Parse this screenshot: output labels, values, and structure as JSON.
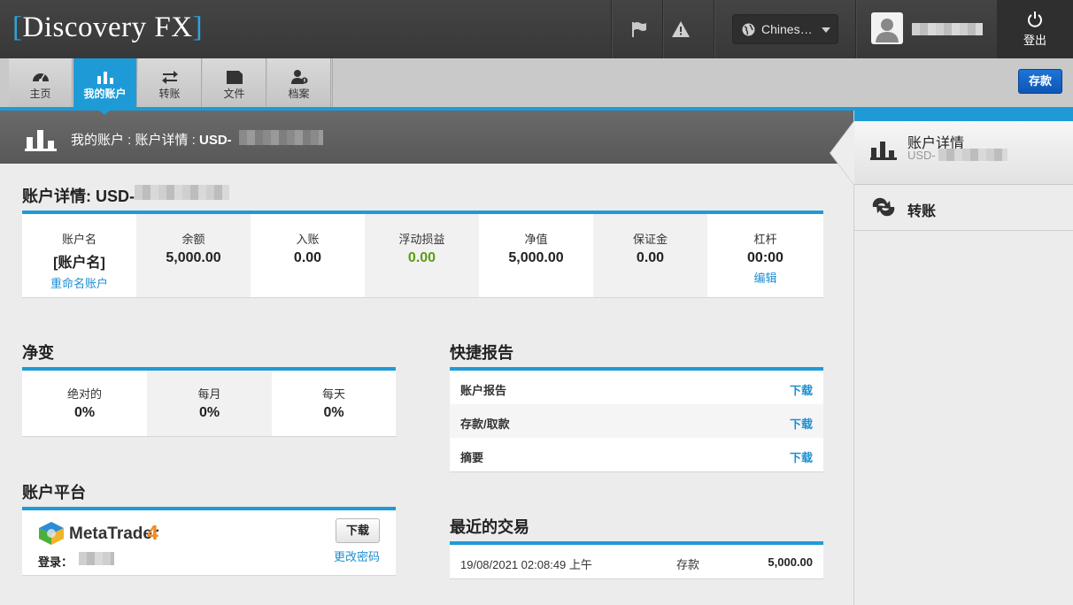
{
  "header": {
    "logo_bracket_open": "[",
    "logo_text": "Discovery FX",
    "logo_bracket_close": "]",
    "language": "Chines…",
    "logout_label": "登出"
  },
  "nav": {
    "items": [
      {
        "label": "主页",
        "icon": "dashboard-icon"
      },
      {
        "label": "我的账户",
        "icon": "bar-chart-icon",
        "active": true
      },
      {
        "label": "转账",
        "icon": "transfer-arrows-icon"
      },
      {
        "label": "文件",
        "icon": "folder-icon"
      },
      {
        "label": "档案",
        "icon": "profile-icon"
      }
    ],
    "deposit_label": "存款"
  },
  "breadcrumb": {
    "part1": "我的账户 : 账户详情 : ",
    "account": "USD-"
  },
  "sidebar": {
    "active_title": "账户详情",
    "active_sub": "USD-",
    "item2": "转账"
  },
  "account_details": {
    "title": "账户详情: USD-",
    "columns": [
      {
        "title": "账户名",
        "value": "[账户名]",
        "link": "重命名账户"
      },
      {
        "title": "余额",
        "value": "5,000.00"
      },
      {
        "title": "入账",
        "value": "0.00"
      },
      {
        "title": "浮动损益",
        "value": "0.00"
      },
      {
        "title": "净值",
        "value": "5,000.00"
      },
      {
        "title": "保证金",
        "value": "0.00"
      },
      {
        "title": "杠杆",
        "value": "00:00",
        "link": "编辑"
      }
    ]
  },
  "net_change": {
    "title": "净变",
    "columns": [
      {
        "title": "绝对的",
        "value": "0%"
      },
      {
        "title": "每月",
        "value": "0%"
      },
      {
        "title": "每天",
        "value": "0%"
      }
    ]
  },
  "quick_reports": {
    "title": "快捷报告",
    "rows": [
      {
        "label": "账户报告",
        "action": "下载"
      },
      {
        "label": "存款/取款",
        "action": "下载"
      },
      {
        "label": "摘要",
        "action": "下载"
      }
    ]
  },
  "platform": {
    "title": "账户平台",
    "name": "MetaTrader",
    "version": "4",
    "login_label": "登录：",
    "download_label": "下载",
    "change_password": "更改密码"
  },
  "recent_trades": {
    "title": "最近的交易",
    "rows": [
      {
        "date": "19/08/2021 02:08:49 上午",
        "type": "存款",
        "amount": "5,000.00"
      }
    ]
  },
  "colors": {
    "accent": "#1e9bd7",
    "positive": "#5d9c15",
    "link": "#1e8fd0"
  }
}
